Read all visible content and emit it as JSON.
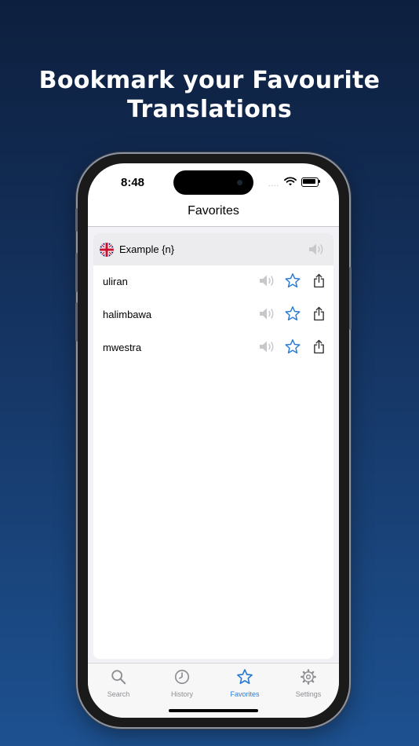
{
  "headline": {
    "line1": "Bookmark your Favourite",
    "line2": "Translations"
  },
  "status_bar": {
    "time": "8:48",
    "cell_signal": "...."
  },
  "nav": {
    "title": "Favorites"
  },
  "header_row": {
    "text": "Example {n}",
    "flag_icon": "uk-flag-icon",
    "speaker_icon": "speaker-icon"
  },
  "favorites": [
    {
      "word": "uliran"
    },
    {
      "word": "halimbawa"
    },
    {
      "word": "mwestra"
    }
  ],
  "tabs": [
    {
      "label": "Search",
      "icon": "search-icon"
    },
    {
      "label": "History",
      "icon": "clock-icon"
    },
    {
      "label": "Favorites",
      "icon": "star-icon",
      "active": true
    },
    {
      "label": "Settings",
      "icon": "gear-icon"
    }
  ],
  "colors": {
    "accent": "#2a7bd4",
    "background_top": "#0d1f3e",
    "background_bottom": "#1d5190",
    "inactive": "#8e8e93"
  }
}
